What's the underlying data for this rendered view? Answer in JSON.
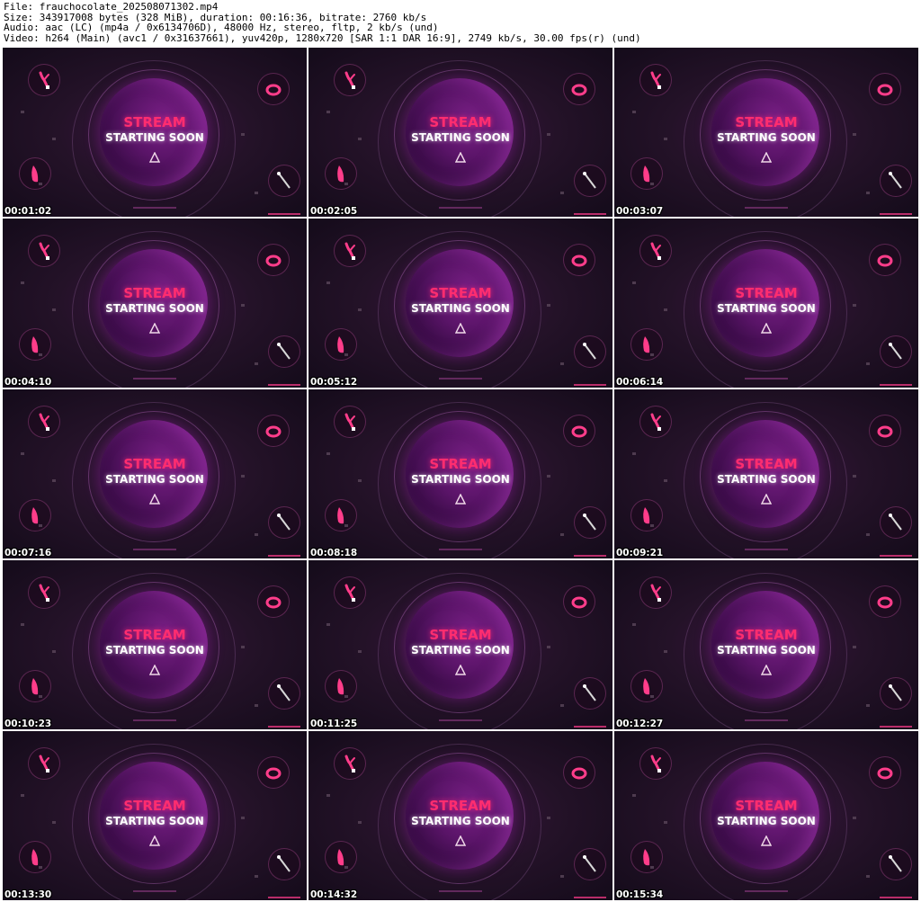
{
  "header": {
    "file": "File: frauchocolate_202508071302.mp4",
    "size": "Size: 343917008 bytes (328 MiB), duration: 00:16:36, bitrate: 2760 kb/s",
    "audio": "Audio: aac (LC) (mp4a / 0x6134706D), 48000 Hz, stereo, fltp, 2 kb/s (und)",
    "video": "Video: h264 (Main) (avc1 / 0x31637661), yuv420p, 1280x720 [SAR 1:1 DAR 16:9], 2749 kb/s, 30.00 fps(r) (und)"
  },
  "thumbs": [
    {
      "line1": "STREAM",
      "line2": "STARTING SOON",
      "time": "00:01:02"
    },
    {
      "line1": "STREAM",
      "line2": "STARTING SOON",
      "time": "00:02:05"
    },
    {
      "line1": "STREAM",
      "line2": "STARTING SOON",
      "time": "00:03:07"
    },
    {
      "line1": "STREAM",
      "line2": "STARTING SOON",
      "time": "00:04:10"
    },
    {
      "line1": "STREAM",
      "line2": "STARTING SOON",
      "time": "00:05:12"
    },
    {
      "line1": "STREAM",
      "line2": "STARTING SOON",
      "time": "00:06:14"
    },
    {
      "line1": "STREAM",
      "line2": "STARTING SOON",
      "time": "00:07:16"
    },
    {
      "line1": "STREAM",
      "line2": "STARTING SOON",
      "time": "00:08:18"
    },
    {
      "line1": "STREAM",
      "line2": "STARTING SOON",
      "time": "00:09:21"
    },
    {
      "line1": "STREAM",
      "line2": "STARTING SOON",
      "time": "00:10:23"
    },
    {
      "line1": "STREAM",
      "line2": "STARTING SOON",
      "time": "00:11:25"
    },
    {
      "line1": "STREAM",
      "line2": "STARTING SOON",
      "time": "00:12:27"
    },
    {
      "line1": "STREAM",
      "line2": "STARTING SOON",
      "time": "00:13:30"
    },
    {
      "line1": "STREAM",
      "line2": "STARTING SOON",
      "time": "00:14:32"
    },
    {
      "line1": "STREAM",
      "line2": "STARTING SOON",
      "time": "00:15:34"
    }
  ],
  "colors": {
    "accent_pink": "#ff2d6f",
    "orb_purple": "#5a1468",
    "background_dark": "#241228"
  },
  "icons": [
    "rabbit-toy-icon",
    "egg-toy-icon",
    "wand-toy-icon",
    "bullet-toy-icon",
    "triangle-play-icon"
  ]
}
